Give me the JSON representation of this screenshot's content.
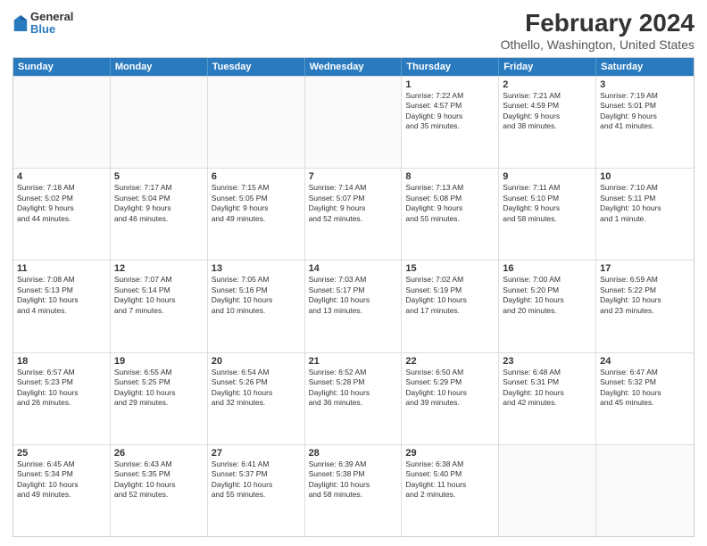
{
  "logo": {
    "general": "General",
    "blue": "Blue"
  },
  "header": {
    "title": "February 2024",
    "subtitle": "Othello, Washington, United States"
  },
  "days": [
    "Sunday",
    "Monday",
    "Tuesday",
    "Wednesday",
    "Thursday",
    "Friday",
    "Saturday"
  ],
  "rows": [
    [
      {
        "day": "",
        "content": ""
      },
      {
        "day": "",
        "content": ""
      },
      {
        "day": "",
        "content": ""
      },
      {
        "day": "",
        "content": ""
      },
      {
        "day": "1",
        "content": "Sunrise: 7:22 AM\nSunset: 4:57 PM\nDaylight: 9 hours\nand 35 minutes."
      },
      {
        "day": "2",
        "content": "Sunrise: 7:21 AM\nSunset: 4:59 PM\nDaylight: 9 hours\nand 38 minutes."
      },
      {
        "day": "3",
        "content": "Sunrise: 7:19 AM\nSunset: 5:01 PM\nDaylight: 9 hours\nand 41 minutes."
      }
    ],
    [
      {
        "day": "4",
        "content": "Sunrise: 7:18 AM\nSunset: 5:02 PM\nDaylight: 9 hours\nand 44 minutes."
      },
      {
        "day": "5",
        "content": "Sunrise: 7:17 AM\nSunset: 5:04 PM\nDaylight: 9 hours\nand 46 minutes."
      },
      {
        "day": "6",
        "content": "Sunrise: 7:15 AM\nSunset: 5:05 PM\nDaylight: 9 hours\nand 49 minutes."
      },
      {
        "day": "7",
        "content": "Sunrise: 7:14 AM\nSunset: 5:07 PM\nDaylight: 9 hours\nand 52 minutes."
      },
      {
        "day": "8",
        "content": "Sunrise: 7:13 AM\nSunset: 5:08 PM\nDaylight: 9 hours\nand 55 minutes."
      },
      {
        "day": "9",
        "content": "Sunrise: 7:11 AM\nSunset: 5:10 PM\nDaylight: 9 hours\nand 58 minutes."
      },
      {
        "day": "10",
        "content": "Sunrise: 7:10 AM\nSunset: 5:11 PM\nDaylight: 10 hours\nand 1 minute."
      }
    ],
    [
      {
        "day": "11",
        "content": "Sunrise: 7:08 AM\nSunset: 5:13 PM\nDaylight: 10 hours\nand 4 minutes."
      },
      {
        "day": "12",
        "content": "Sunrise: 7:07 AM\nSunset: 5:14 PM\nDaylight: 10 hours\nand 7 minutes."
      },
      {
        "day": "13",
        "content": "Sunrise: 7:05 AM\nSunset: 5:16 PM\nDaylight: 10 hours\nand 10 minutes."
      },
      {
        "day": "14",
        "content": "Sunrise: 7:03 AM\nSunset: 5:17 PM\nDaylight: 10 hours\nand 13 minutes."
      },
      {
        "day": "15",
        "content": "Sunrise: 7:02 AM\nSunset: 5:19 PM\nDaylight: 10 hours\nand 17 minutes."
      },
      {
        "day": "16",
        "content": "Sunrise: 7:00 AM\nSunset: 5:20 PM\nDaylight: 10 hours\nand 20 minutes."
      },
      {
        "day": "17",
        "content": "Sunrise: 6:59 AM\nSunset: 5:22 PM\nDaylight: 10 hours\nand 23 minutes."
      }
    ],
    [
      {
        "day": "18",
        "content": "Sunrise: 6:57 AM\nSunset: 5:23 PM\nDaylight: 10 hours\nand 26 minutes."
      },
      {
        "day": "19",
        "content": "Sunrise: 6:55 AM\nSunset: 5:25 PM\nDaylight: 10 hours\nand 29 minutes."
      },
      {
        "day": "20",
        "content": "Sunrise: 6:54 AM\nSunset: 5:26 PM\nDaylight: 10 hours\nand 32 minutes."
      },
      {
        "day": "21",
        "content": "Sunrise: 6:52 AM\nSunset: 5:28 PM\nDaylight: 10 hours\nand 36 minutes."
      },
      {
        "day": "22",
        "content": "Sunrise: 6:50 AM\nSunset: 5:29 PM\nDaylight: 10 hours\nand 39 minutes."
      },
      {
        "day": "23",
        "content": "Sunrise: 6:48 AM\nSunset: 5:31 PM\nDaylight: 10 hours\nand 42 minutes."
      },
      {
        "day": "24",
        "content": "Sunrise: 6:47 AM\nSunset: 5:32 PM\nDaylight: 10 hours\nand 45 minutes."
      }
    ],
    [
      {
        "day": "25",
        "content": "Sunrise: 6:45 AM\nSunset: 5:34 PM\nDaylight: 10 hours\nand 49 minutes."
      },
      {
        "day": "26",
        "content": "Sunrise: 6:43 AM\nSunset: 5:35 PM\nDaylight: 10 hours\nand 52 minutes."
      },
      {
        "day": "27",
        "content": "Sunrise: 6:41 AM\nSunset: 5:37 PM\nDaylight: 10 hours\nand 55 minutes."
      },
      {
        "day": "28",
        "content": "Sunrise: 6:39 AM\nSunset: 5:38 PM\nDaylight: 10 hours\nand 58 minutes."
      },
      {
        "day": "29",
        "content": "Sunrise: 6:38 AM\nSunset: 5:40 PM\nDaylight: 11 hours\nand 2 minutes."
      },
      {
        "day": "",
        "content": ""
      },
      {
        "day": "",
        "content": ""
      }
    ]
  ]
}
